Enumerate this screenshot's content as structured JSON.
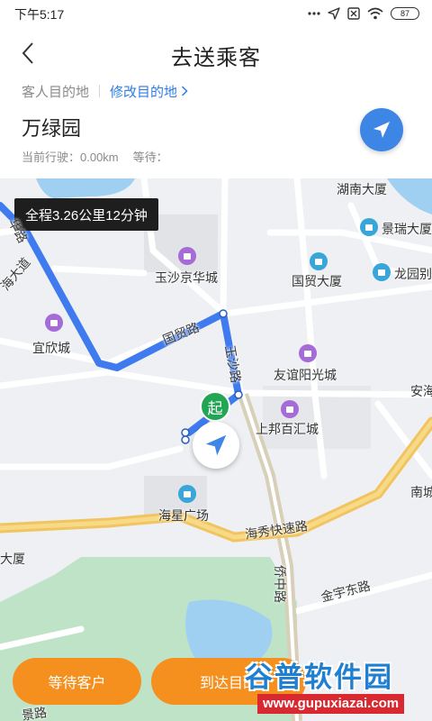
{
  "status_bar": {
    "time": "下午5:17",
    "battery": "87",
    "icons": [
      "dots-icon",
      "location-icon",
      "sim-off-icon",
      "wifi-icon",
      "battery-icon"
    ]
  },
  "header": {
    "title": "去送乘客",
    "back_icon": "chevron-left-icon"
  },
  "destination": {
    "label": "客人目的地",
    "modify_link": "修改目的地",
    "name": "万绿园",
    "distance_label": "当前行驶：0.00km",
    "wait_label": "等待："
  },
  "map": {
    "route_summary": "全程3.26公里12分钟",
    "start_marker": "起",
    "poi_labels": [
      "湖南大厦",
      "景瑞大厦",
      "玉沙京华城",
      "国贸大厦",
      "龙园别",
      "宜欣城",
      "友谊阳光城",
      "安海",
      "上邦百汇城",
      "南城",
      "海星广场",
      "大厦"
    ],
    "road_labels": [
      "国贸路",
      "玉沙路",
      "海秀快速路",
      "侨中路",
      "金宇东路",
      "海大道",
      "华路",
      "路",
      "景路"
    ]
  },
  "actions": {
    "wait_button": "等待客户",
    "arrive_button": "到达目的"
  },
  "watermark": {
    "main": "谷普软件园",
    "sub": "www.gupuxiazai.com"
  },
  "colors": {
    "accent_blue": "#3d86e6",
    "route_blue": "#3f7bef",
    "button_orange": "#f5901f",
    "start_green": "#22a654"
  }
}
